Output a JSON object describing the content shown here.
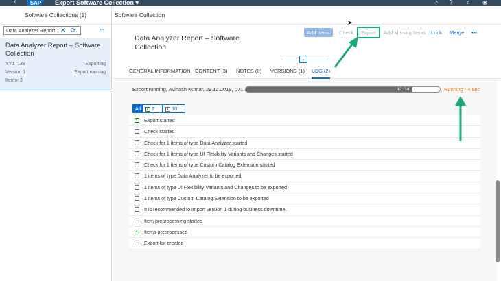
{
  "shell": {
    "app_title": "Export Software Collection",
    "logo": "SAP",
    "icons": [
      "back-icon",
      "search-icon",
      "help-icon",
      "bell-icon",
      "user-icon"
    ]
  },
  "master": {
    "header": "Software Collections (1)",
    "search_value": "Data Analyzer Report...",
    "items": [
      {
        "title": "Data Analyzer Report – Software Collection",
        "id": "YY1_139",
        "status": "Exporting",
        "version": "Version 1",
        "export_status": "Export running",
        "items_count": "Items: 3"
      }
    ]
  },
  "detail": {
    "header": "Software Collection",
    "title": "Data Analyzer Report – Software Collection",
    "toolbar": {
      "add_items": "Add Items",
      "check": "Check",
      "export": "Export",
      "add_missing": "Add Missing Items",
      "lock": "Lock",
      "merge": "Merge",
      "more": "•••"
    },
    "tabs": [
      {
        "label": "GENERAL INFORMATION"
      },
      {
        "label": "CONTENT (3)"
      },
      {
        "label": "NOTES (0)"
      },
      {
        "label": "VERSIONS (1)"
      },
      {
        "label": "LOG (2)"
      }
    ],
    "progress": {
      "text": "Export running, Avinash Kumar, 29.12.2019, 07:...",
      "label": "12 /14",
      "fraction": 0.857,
      "status": "Running / 4 sec"
    },
    "filters": {
      "all": "All",
      "success_count": "2",
      "info_count": "10"
    },
    "log": [
      {
        "type": "success",
        "text": "Export started"
      },
      {
        "type": "info",
        "text": "Check started"
      },
      {
        "type": "info",
        "text": "Check for 1 items of type Data Analyzer started"
      },
      {
        "type": "info",
        "text": "Check for 1 items of type UI Flexibility Variants and Changes started"
      },
      {
        "type": "info",
        "text": "Check for 1 items of type Custom Catalog Extension started"
      },
      {
        "type": "info",
        "text": "1 items of type Data Analyzer to be exported"
      },
      {
        "type": "info",
        "text": "1 items of type UI Flexibility Variants and Changes to be exported"
      },
      {
        "type": "info",
        "text": "1 items of type Custom Catalog Extension to be exported"
      },
      {
        "type": "info",
        "text": "It is recommended to import version 1 during business downtime."
      },
      {
        "type": "info",
        "text": "Item preprocessing started"
      },
      {
        "type": "success",
        "text": "Items preprocessed"
      },
      {
        "type": "info",
        "text": "Export list created"
      }
    ]
  },
  "colors": {
    "shell": "#354a5f",
    "accent": "#0a6ed1",
    "running": "#e9730c",
    "annotation": "#1aa97b"
  }
}
